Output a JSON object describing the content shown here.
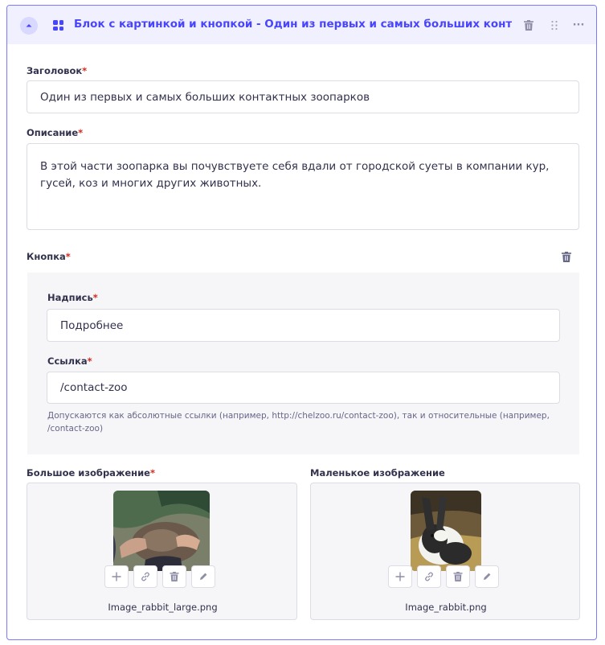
{
  "header": {
    "title": "Блок с картинкой и кнопкой - Один из первых и самых больших контактны...",
    "more": "···"
  },
  "fields": {
    "title_label": "Заголовок",
    "title_value": "Один из первых и самых больших контактных зоопарков",
    "description_label": "Описание",
    "description_value": "В этой части зоопарка вы почувствуете себя вдали от городской суеты в компании кур, гусей, коз и многих других животных."
  },
  "button_group": {
    "label": "Кнопка",
    "caption_label": "Надпись",
    "caption_value": "Подробнее",
    "link_label": "Ссылка",
    "link_value": "/contact-zoo",
    "link_hint": "Допускаются как абсолютные ссылки (например, http://chelzoo.ru/contact-zoo), так и относительные (например, /contact-zoo)"
  },
  "media": {
    "large": {
      "label": "Большое изображение",
      "filename": "Image_rabbit_large.png"
    },
    "small": {
      "label": "Маленькое изображение",
      "filename": "Image_rabbit.png"
    }
  },
  "required_mark": "*",
  "colors": {
    "accent": "#4945ff",
    "header_bg": "#f0f0ff",
    "required": "#d02b20",
    "border": "#dcdce4",
    "group_bg": "#f6f6f9"
  },
  "icons": [
    "chevron-up-icon",
    "grid-icon",
    "trash-icon",
    "drag-handle-icon",
    "more-icon",
    "plus-icon",
    "link-icon",
    "pencil-icon"
  ]
}
